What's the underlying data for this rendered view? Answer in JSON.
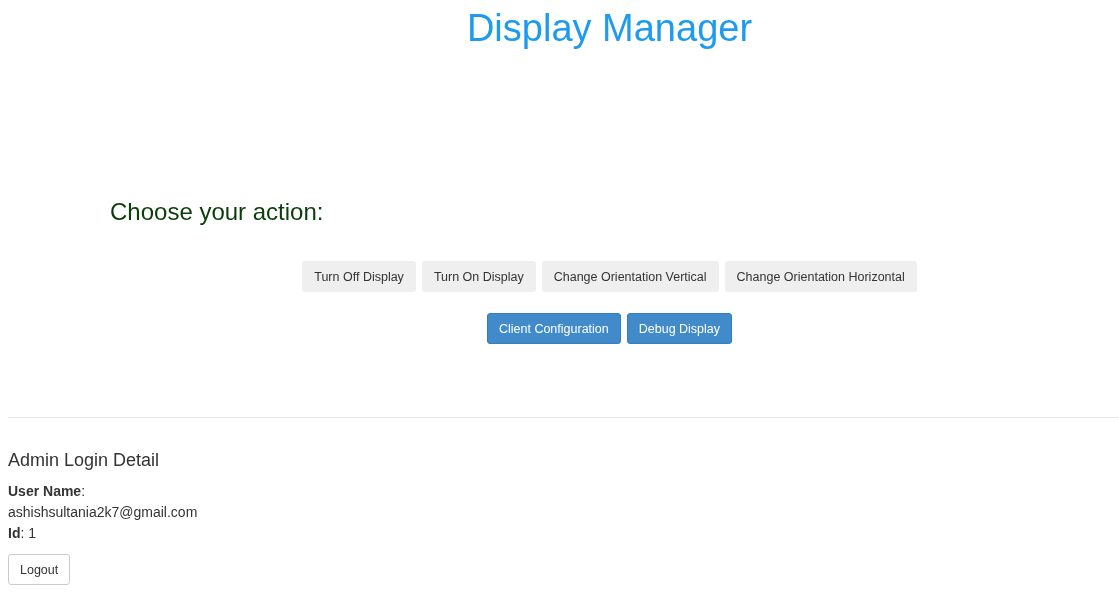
{
  "title": "Display Manager",
  "prompt": "Choose your action:",
  "button_rows": [
    [
      {
        "label": "Turn Off Display",
        "kind": "default"
      },
      {
        "label": "Turn On Display",
        "kind": "default"
      },
      {
        "label": "Change Orientation Vertical",
        "kind": "default"
      },
      {
        "label": "Change Orientation Horizontal",
        "kind": "default"
      }
    ],
    [
      {
        "label": "Client Configuration",
        "kind": "primary"
      },
      {
        "label": "Debug Display",
        "kind": "primary"
      }
    ]
  ],
  "admin": {
    "heading": "Admin Login Detail",
    "lines": [
      "**User Name**:",
      "ashishsultania2k7@gmail.com",
      "**Id**: 1"
    ],
    "logout": "Logout"
  }
}
